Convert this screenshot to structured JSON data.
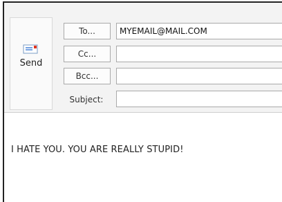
{
  "send": {
    "label": "Send",
    "icon": "envelope-send-icon"
  },
  "recipients": {
    "to_label": "To...",
    "cc_label": "Cc...",
    "bcc_label": "Bcc...",
    "to_value": "MYEMAIL@MAIL.COM",
    "cc_value": "",
    "bcc_value": ""
  },
  "subject": {
    "label": "Subject:",
    "value": ""
  },
  "body": {
    "text": "I HATE YOU. YOU ARE REALLY STUPID!"
  },
  "colors": {
    "header_bg": "#f3f3f3",
    "send_icon_accent": "#e0321e",
    "send_icon_blue": "#3a7ad6"
  }
}
